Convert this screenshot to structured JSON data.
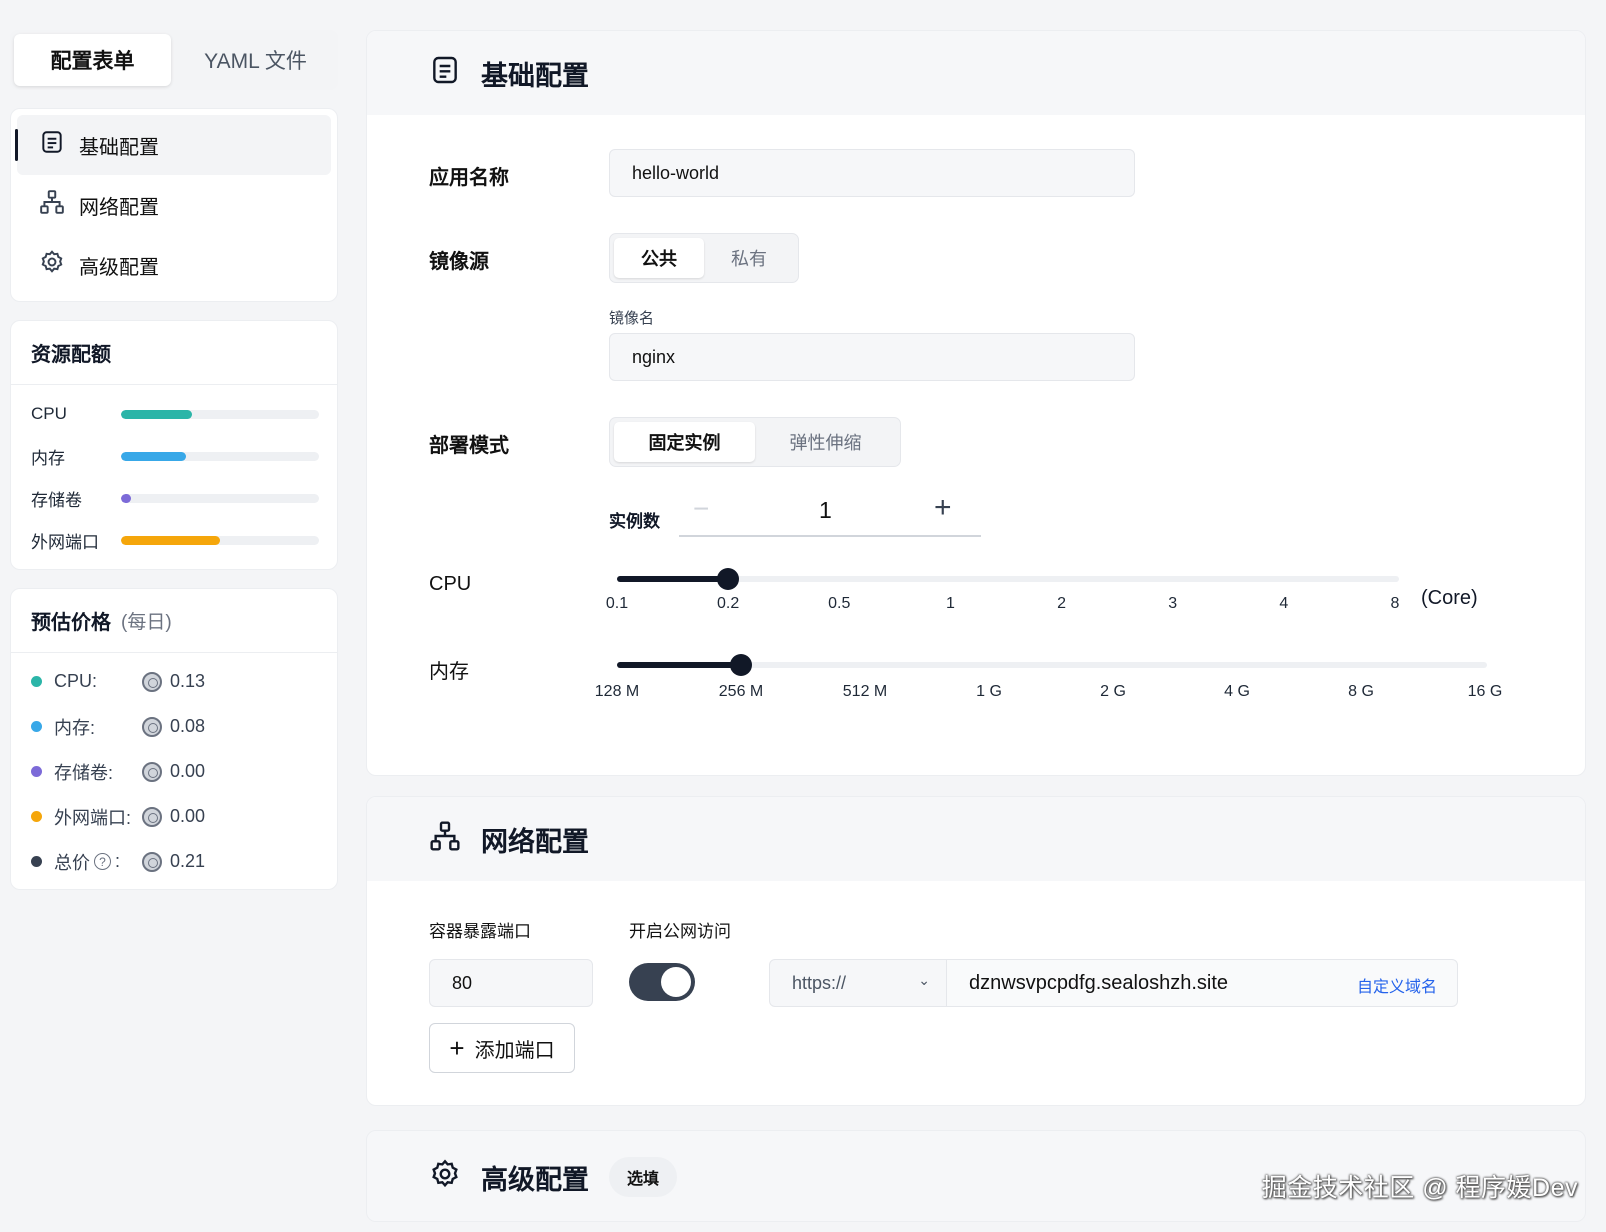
{
  "tabs": {
    "form": "配置表单",
    "yaml": "YAML 文件"
  },
  "nav": [
    {
      "label": "基础配置",
      "icon": "list-icon"
    },
    {
      "label": "网络配置",
      "icon": "network-icon"
    },
    {
      "label": "高级配置",
      "icon": "gear-icon"
    }
  ],
  "quota": {
    "title": "资源配额",
    "items": [
      {
        "label": "CPU",
        "percent": 36,
        "color": "#2bb5a8"
      },
      {
        "label": "内存",
        "percent": 33,
        "color": "#38a8e8"
      },
      {
        "label": "存储卷",
        "percent": 5,
        "color": "#7c6ad8"
      },
      {
        "label": "外网端口",
        "percent": 50,
        "color": "#f5a60b"
      }
    ]
  },
  "price": {
    "title": "预估价格",
    "subtitle": "(每日)",
    "items": [
      {
        "label": "CPU:",
        "value": "0.13",
        "color": "#2bb5a8"
      },
      {
        "label": "内存:",
        "value": "0.08",
        "color": "#38a8e8"
      },
      {
        "label": "存储卷:",
        "value": "0.00",
        "color": "#7c6ad8"
      },
      {
        "label": "外网端口:",
        "value": "0.00",
        "color": "#f5a60b"
      },
      {
        "label": "总价",
        "suffix": ":",
        "value": "0.21",
        "color": "#374151"
      }
    ]
  },
  "basic": {
    "title": "基础配置",
    "app_name_label": "应用名称",
    "app_name_value": "hello-world",
    "image_source_label": "镜像源",
    "image_source_options": [
      "公共",
      "私有"
    ],
    "image_name_label": "镜像名",
    "image_name_value": "nginx",
    "deploy_mode_label": "部署模式",
    "deploy_mode_options": [
      "固定实例",
      "弹性伸缩"
    ],
    "instances_label": "实例数",
    "instances_value": "1",
    "cpu_label": "CPU",
    "cpu_ticks": [
      "0.1",
      "0.2",
      "0.5",
      "1",
      "2",
      "3",
      "4",
      "8"
    ],
    "cpu_unit": "(Core)",
    "cpu_value": "0.2",
    "mem_label": "内存",
    "mem_ticks": [
      "128 M",
      "256 M",
      "512 M",
      "1 G",
      "2 G",
      "4 G",
      "8 G",
      "16 G"
    ],
    "mem_value": "256 M"
  },
  "network": {
    "title": "网络配置",
    "port_label": "容器暴露端口",
    "public_label": "开启公网访问",
    "port_value": "80",
    "public_enabled": true,
    "protocol": "https://",
    "domain": "dznwsvpcpdfg.sealoshzh.site",
    "custom_domain": "自定义域名",
    "add_port": "添加端口"
  },
  "advanced": {
    "title": "高级配置",
    "badge": "选填"
  },
  "watermark": "掘金技术社区 @ 程序媛Dev"
}
